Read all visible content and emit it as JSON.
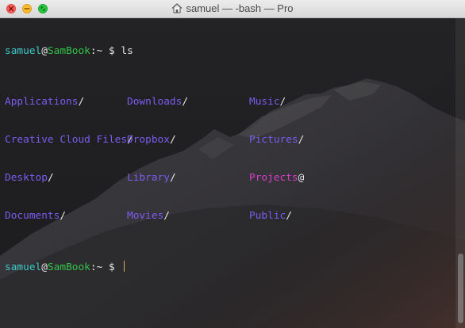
{
  "window": {
    "title": "samuel — -bash — Pro",
    "title_icon": "home-icon"
  },
  "colors": {
    "user": "#3ec9c9",
    "host": "#33c24a",
    "directory": "#7b5cf0",
    "symlink": "#d63dc8",
    "cursor": "#d9b14b"
  },
  "prompt": {
    "user": "samuel",
    "at": "@",
    "host": "SamBook",
    "path": ":~ $ "
  },
  "command": "ls",
  "listing": [
    [
      {
        "name": "Applications",
        "suffix": "/",
        "kind": "directory"
      },
      {
        "name": "Downloads",
        "suffix": "/",
        "kind": "directory"
      },
      {
        "name": "Music",
        "suffix": "/",
        "kind": "directory"
      }
    ],
    [
      {
        "name": "Creative Cloud Files",
        "suffix": "/",
        "kind": "directory"
      },
      {
        "name": "Dropbox",
        "suffix": "/",
        "kind": "directory"
      },
      {
        "name": "Pictures",
        "suffix": "/",
        "kind": "directory"
      }
    ],
    [
      {
        "name": "Desktop",
        "suffix": "/",
        "kind": "directory"
      },
      {
        "name": "Library",
        "suffix": "/",
        "kind": "directory"
      },
      {
        "name": "Projects",
        "suffix": "@",
        "kind": "symlink"
      }
    ],
    [
      {
        "name": "Documents",
        "suffix": "/",
        "kind": "directory"
      },
      {
        "name": "Movies",
        "suffix": "/",
        "kind": "directory"
      },
      {
        "name": "Public",
        "suffix": "/",
        "kind": "directory"
      }
    ]
  ]
}
